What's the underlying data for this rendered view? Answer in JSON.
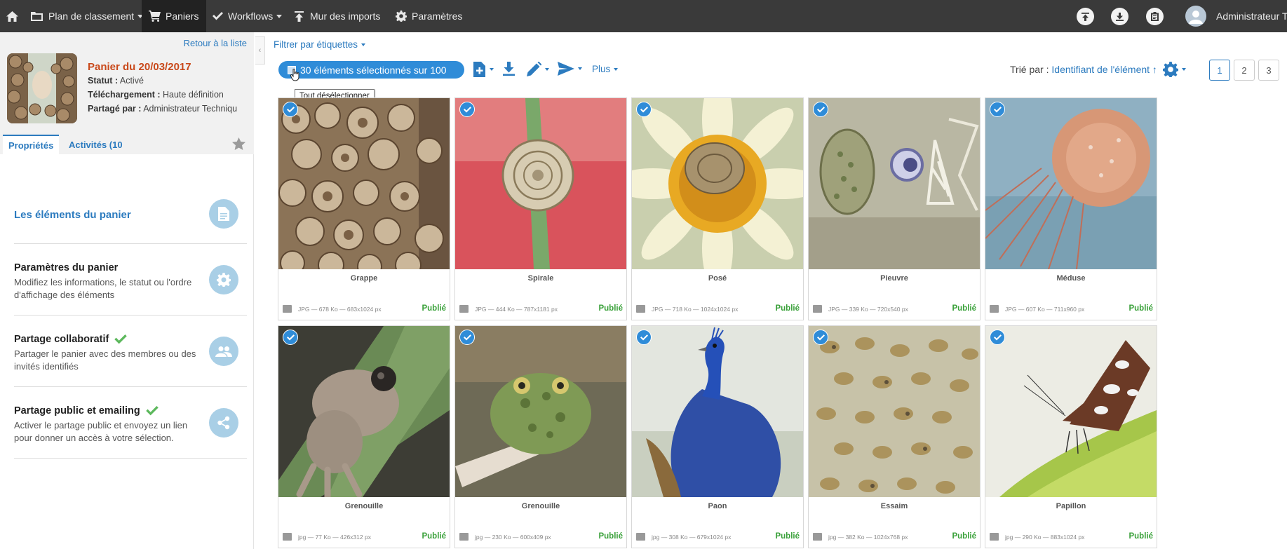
{
  "topbar": {
    "nav": [
      {
        "label": "Plan de classement",
        "icon": "folder-icon",
        "has_caret": true
      },
      {
        "label": "Paniers",
        "icon": "cart-icon",
        "has_caret": false,
        "active": true
      },
      {
        "label": "Workflows",
        "icon": "check-icon",
        "has_caret": true
      },
      {
        "label": "Mur des imports",
        "icon": "upload-icon",
        "has_caret": false
      },
      {
        "label": "Paramètres",
        "icon": "gear-icon",
        "has_caret": false
      }
    ],
    "user_name": "Administrateur T"
  },
  "sidebar": {
    "back_link": "Retour à la liste",
    "cart_title": "Panier du 20/03/2017",
    "meta": [
      {
        "label": "Statut :",
        "value": "Activé"
      },
      {
        "label": "Téléchargement :",
        "value": "Haute définition"
      },
      {
        "label": "Partagé par :",
        "value": "Administrateur Techniqu"
      }
    ],
    "tabs": [
      {
        "label": "Propriétés",
        "active": true
      },
      {
        "label": "Activités (10",
        "active": false
      }
    ],
    "items": [
      {
        "title": "Les éléments du panier",
        "desc": "",
        "icon": "document-icon",
        "highlight": true,
        "check": false
      },
      {
        "title": "Paramètres du panier",
        "desc": "Modifiez les informations, le statut ou l'ordre d'affichage des éléments",
        "icon": "gear-icon",
        "highlight": false,
        "check": false
      },
      {
        "title": "Partage collaboratif",
        "desc": "Partager le panier avec des membres ou des invités identifiés",
        "icon": "people-icon",
        "highlight": false,
        "check": true
      },
      {
        "title": "Partage public et emailing",
        "desc": "Activer le partage public et envoyez un lien pour donner un accès à votre sélection.",
        "icon": "share-icon",
        "highlight": false,
        "check": true
      }
    ]
  },
  "toolbar": {
    "filter_label": "Filtrer par étiquettes",
    "selection_label": "30 éléments sélectionnés sur 100",
    "tooltip": "Tout désélectionner",
    "more_label": "Plus",
    "sort_prefix": "Trié par :",
    "sort_value": "Identifiant de l'élément ↑",
    "pages": [
      "1",
      "2",
      "3"
    ],
    "current_page": "1"
  },
  "elements": [
    {
      "name": "Grappe",
      "info": "JPG — 678 Ko — 683x1024 px",
      "status": "Publié",
      "theme": "snails"
    },
    {
      "name": "Spirale",
      "info": "JPG — 444 Ko — 787x1181 px",
      "status": "Publié",
      "theme": "spiral"
    },
    {
      "name": "Posé",
      "info": "JPG — 718 Ko — 1024x1024 px",
      "status": "Publié",
      "theme": "daisy"
    },
    {
      "name": "Pieuvre",
      "info": "JPG — 339 Ko — 720x540 px",
      "status": "Publié",
      "theme": "wall"
    },
    {
      "name": "Méduse",
      "info": "JPG — 607 Ko — 711x960 px",
      "status": "Publié",
      "theme": "jelly"
    },
    {
      "name": "Grenouille",
      "info": "jpg — 77 Ko — 426x312 px",
      "status": "Publié",
      "theme": "frog1"
    },
    {
      "name": "Grenouille",
      "info": "jpg — 230 Ko — 600x409 px",
      "status": "Publié",
      "theme": "frog2"
    },
    {
      "name": "Paon",
      "info": "jpg — 308 Ko — 679x1024 px",
      "status": "Publié",
      "theme": "peacock"
    },
    {
      "name": "Essaim",
      "info": "jpg — 382 Ko — 1024x768 px",
      "status": "Publié",
      "theme": "bees"
    },
    {
      "name": "Papillon",
      "info": "jpg — 290 Ko — 883x1024 px",
      "status": "Publié",
      "theme": "butterfly"
    }
  ],
  "colors": {
    "accent": "#2f8cd8",
    "title_orange": "#c9491b",
    "published_green": "#3aa13a",
    "topbar": "#3a3a3a"
  }
}
